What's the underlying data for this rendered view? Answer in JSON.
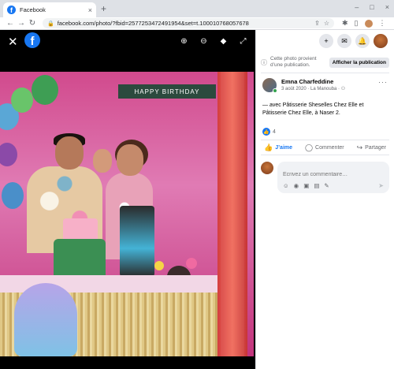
{
  "browser": {
    "tab_title": "Facebook",
    "tab_favicon": "f",
    "tab_close": "×",
    "new_tab": "+",
    "window_buttons": [
      "–",
      "□",
      "×"
    ],
    "nav": {
      "back": "←",
      "forward": "→",
      "reload": "↻"
    },
    "url": "facebook.com/photo/?fbid=2577253472491954&set=t.100010768057678",
    "url_lock": "🔒",
    "omnibox_icons": [
      "⇪",
      "☆"
    ],
    "extensions": [
      "✱",
      "▯",
      "⋮"
    ]
  },
  "viewer": {
    "close": "✕",
    "logo": "f",
    "tools": {
      "zoom_in": "⊕",
      "zoom_out": "⊖",
      "tag": "◆",
      "fullscreen": "⤢"
    },
    "sign_text": "HAPPY BIRTHDAY"
  },
  "panel": {
    "topbar": {
      "create": "+",
      "messenger": "✉",
      "notifications": "🔔"
    },
    "notice": {
      "text": "Cette photo provient d’une publication.",
      "button": "Afficher la publication"
    },
    "author": {
      "name": "Emna Charfeddine",
      "meta": "3 août 2020 · La Manouba · ⚇",
      "more": "···"
    },
    "caption": "— avec Pâtisserie Sheselles Chez Elle et Pâtisserie Chez Elle, à Naser 2.",
    "reactions": {
      "count": "4",
      "like_icon": "👍"
    },
    "actions": {
      "like": "J’aime",
      "comment": "Commenter",
      "share": "Partager"
    },
    "comment": {
      "placeholder": "Écrivez un commentaire…",
      "tools": [
        "☺",
        "◉",
        "▣",
        "▤",
        "✎"
      ],
      "send": "➤"
    }
  }
}
